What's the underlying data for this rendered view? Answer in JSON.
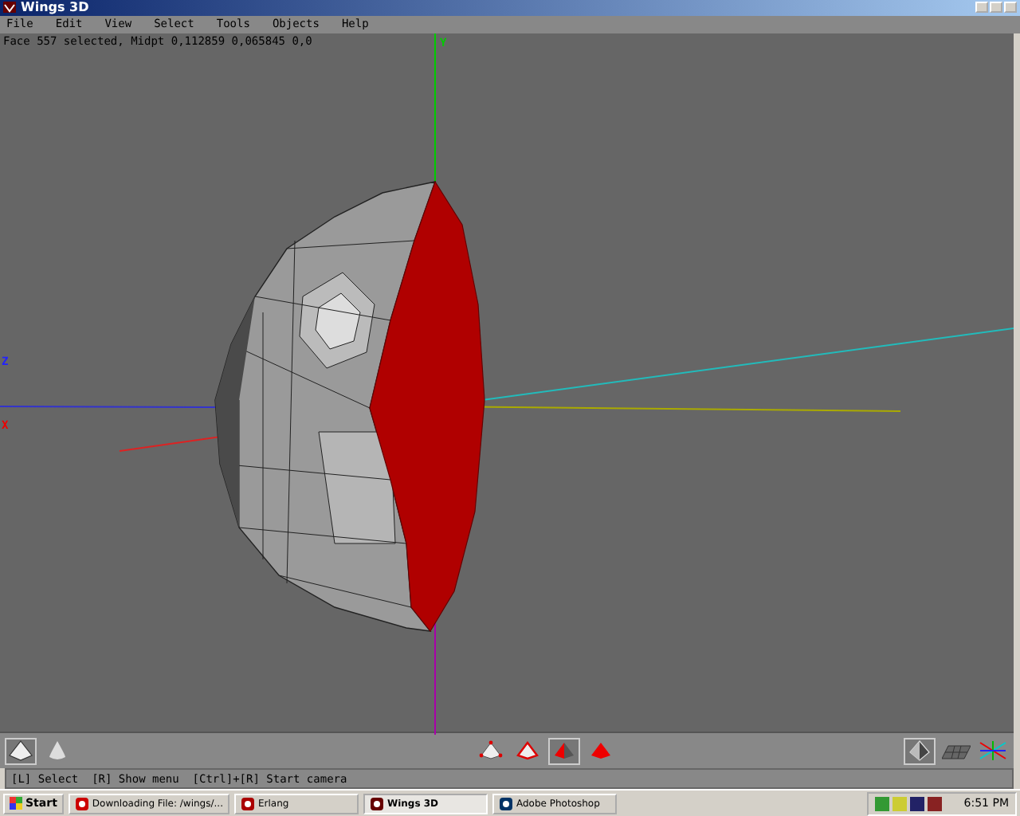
{
  "window": {
    "title": "Wings 3D"
  },
  "menu": [
    "File",
    "Edit",
    "View",
    "Select",
    "Tools",
    "Objects",
    "Help"
  ],
  "info": "Face 557 selected, Midpt 0,112859 0,065845 0,0",
  "axes": [
    {
      "kind": "y",
      "label": "Y"
    },
    {
      "kind": "z",
      "label": "Z"
    },
    {
      "kind": "x",
      "label": "X"
    }
  ],
  "toolbar": {
    "left": [
      {
        "kind": "smooth-off",
        "selected": true
      },
      {
        "kind": "smooth-on",
        "selected": false
      }
    ],
    "modes": [
      {
        "kind": "vertex",
        "selected": false
      },
      {
        "kind": "edge",
        "selected": false
      },
      {
        "kind": "face",
        "selected": true
      },
      {
        "kind": "body",
        "selected": false
      }
    ],
    "right": [
      {
        "kind": "wire",
        "selected": true
      },
      {
        "kind": "ground",
        "selected": false
      },
      {
        "kind": "axes",
        "selected": false
      }
    ]
  },
  "status": "[L] Select  [R] Show menu  [Ctrl]+[R] Start camera",
  "taskbar": {
    "start": "Start",
    "items": [
      {
        "kind": "browser",
        "label": "Downloading File: /wings/...",
        "selected": false
      },
      {
        "kind": "erlang",
        "label": "Erlang",
        "selected": false
      },
      {
        "kind": "wings",
        "label": "Wings 3D",
        "selected": true
      },
      {
        "kind": "photoshop",
        "label": "Adobe Photoshop",
        "selected": false
      }
    ],
    "time": "6:51 PM"
  }
}
